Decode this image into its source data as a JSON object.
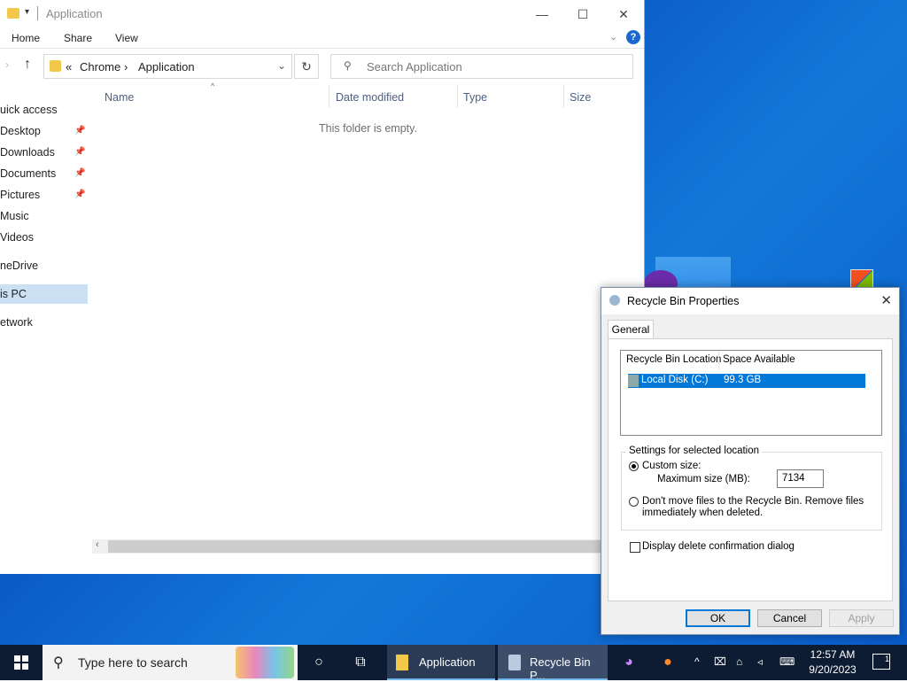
{
  "explorer": {
    "title": "Application",
    "ribbon_tabs": [
      "Home",
      "Share",
      "View"
    ],
    "address": {
      "root_glyph": "«",
      "crumbs": [
        "Chrome",
        "Application"
      ],
      "sep": "›"
    },
    "search_placeholder": "Search Application",
    "sidebar": [
      {
        "label": "uick access",
        "pinned": false
      },
      {
        "label": "Desktop",
        "pinned": true
      },
      {
        "label": "Downloads",
        "pinned": true
      },
      {
        "label": "Documents",
        "pinned": true
      },
      {
        "label": "Pictures",
        "pinned": true
      },
      {
        "label": "Music",
        "pinned": false
      },
      {
        "label": "Videos",
        "pinned": false
      },
      {
        "label": "neDrive",
        "pinned": false
      },
      {
        "label": "is PC",
        "pinned": false,
        "selected": true
      },
      {
        "label": "etwork",
        "pinned": false
      }
    ],
    "columns": [
      "Name",
      "Date modified",
      "Type",
      "Size"
    ],
    "empty_message": "This folder is empty."
  },
  "dialog": {
    "title": "Recycle Bin Properties",
    "tab": "General",
    "list_headers": [
      "Recycle Bin Location",
      "Space Available"
    ],
    "list_rows": [
      {
        "location": "Local Disk (C:)",
        "space": "99.3 GB",
        "selected": true
      }
    ],
    "settings_title": "Settings for selected location",
    "custom_size_label": "Custom size:",
    "max_size_label": "Maximum size (MB):",
    "max_size_value": "7134",
    "dont_move_label_1": "Don't move files to the Recycle Bin. Remove files",
    "dont_move_label_2": "immediately when deleted.",
    "confirm_label": "Display delete confirmation dialog",
    "confirm_checked": false,
    "selected_option": "custom",
    "buttons": {
      "ok": "OK",
      "cancel": "Cancel",
      "apply": "Apply"
    }
  },
  "taskbar": {
    "search_placeholder": "Type here to search",
    "apps": [
      {
        "label": "Application",
        "icon": "folder-icon"
      },
      {
        "label": "Recycle Bin P...",
        "icon": "recycle-bin-icon"
      }
    ],
    "time": "12:57 AM",
    "date": "9/20/2023",
    "notifications": "1"
  }
}
